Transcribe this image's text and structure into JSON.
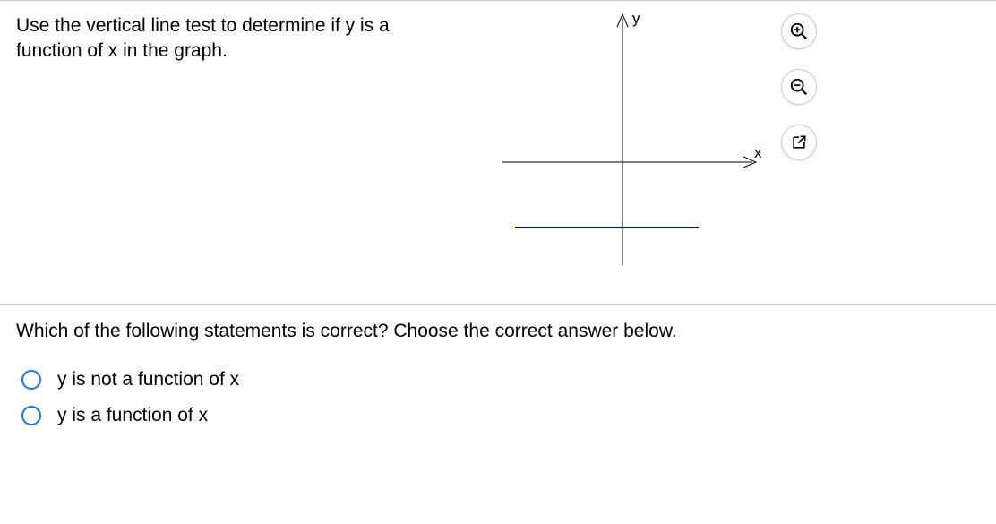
{
  "question": "Use the vertical line test to determine if y is a function of x in the graph.",
  "axis": {
    "y": "y",
    "x": "x"
  },
  "answer_prompt": "Which of the following statements is correct?  Choose the correct answer below.",
  "options": [
    {
      "label": "y is not a function of x"
    },
    {
      "label": "y is a function of x"
    }
  ],
  "chart_data": {
    "type": "line",
    "title": "",
    "xlabel": "x",
    "ylabel": "y",
    "description": "Cartesian axes with a single horizontal blue line segment below the x-axis (constant y value)",
    "series": [
      {
        "name": "graph",
        "points": "horizontal segment at constant negative y, spanning a finite x-interval around the origin"
      }
    ]
  }
}
